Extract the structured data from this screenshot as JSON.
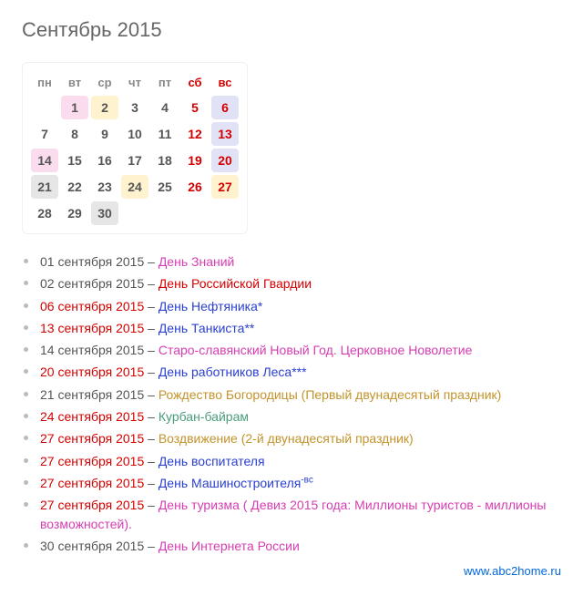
{
  "title": "Сентябрь 2015",
  "weekdays": [
    "пн",
    "вт",
    "ср",
    "чт",
    "пт",
    "сб",
    "вс"
  ],
  "calendar": [
    [
      null,
      {
        "d": 1,
        "hl": "pink"
      },
      {
        "d": 2,
        "hl": "yellow"
      },
      {
        "d": 3
      },
      {
        "d": 4
      },
      {
        "d": 5,
        "w": true
      },
      {
        "d": 6,
        "w": true,
        "hl": "violet"
      }
    ],
    [
      {
        "d": 7
      },
      {
        "d": 8
      },
      {
        "d": 9
      },
      {
        "d": 10
      },
      {
        "d": 11
      },
      {
        "d": 12,
        "w": true
      },
      {
        "d": 13,
        "w": true,
        "hl": "violet"
      }
    ],
    [
      {
        "d": 14,
        "hl": "pink"
      },
      {
        "d": 15
      },
      {
        "d": 16
      },
      {
        "d": 17
      },
      {
        "d": 18
      },
      {
        "d": 19,
        "w": true
      },
      {
        "d": 20,
        "w": true,
        "hl": "violet"
      }
    ],
    [
      {
        "d": 21,
        "hl": "grey"
      },
      {
        "d": 22
      },
      {
        "d": 23
      },
      {
        "d": 24,
        "hl": "yellow"
      },
      {
        "d": 25
      },
      {
        "d": 26,
        "w": true
      },
      {
        "d": 27,
        "w": true,
        "hl": "yellow"
      }
    ],
    [
      {
        "d": 28
      },
      {
        "d": 29
      },
      {
        "d": 30,
        "hl": "grey"
      },
      null,
      null,
      null,
      null
    ]
  ],
  "events": [
    {
      "date": "01 сентября 2015",
      "dc": "black",
      "name": "День Знаний",
      "ec": "magenta"
    },
    {
      "date": "02 сентября 2015",
      "dc": "black",
      "name": "День Российской Гвардии",
      "ec": "red"
    },
    {
      "date": "06 сентября 2015",
      "dc": "red",
      "name": "День Нефтяника*",
      "ec": "blue"
    },
    {
      "date": "13 сентября 2015",
      "dc": "red",
      "name": "День Танкиста**",
      "ec": "blue"
    },
    {
      "date": "14 сентября 2015",
      "dc": "black",
      "name": "Старо-славянский Новый Год. Церковное Новолетие",
      "ec": "magenta"
    },
    {
      "date": "20 сентября 2015",
      "dc": "red",
      "name": "День работников Леса***",
      "ec": "blue"
    },
    {
      "date": "21 сентября 2015",
      "dc": "black",
      "name": "Рождество Богородицы (Первый двунадесятый праздник)",
      "ec": "olive"
    },
    {
      "date": "24 сентября 2015",
      "dc": "red",
      "name": "Курбан-байрам",
      "ec": "teal"
    },
    {
      "date": "27 сентября 2015",
      "dc": "red",
      "name": "Воздвижение (2-й двунадесятый праздник)",
      "ec": "olive"
    },
    {
      "date": "27 сентября 2015",
      "dc": "red",
      "name": "День воспитателя",
      "ec": "blue"
    },
    {
      "date": "27 сентября 2015",
      "dc": "red",
      "name": "День Машиностроителя",
      "sup": "-вс",
      "ec": "blue"
    },
    {
      "date": "27 сентября 2015",
      "dc": "red",
      "name": "День туризма ( Девиз 2015 года: Миллионы туристов - миллионы возможностей).",
      "ec": "magenta"
    },
    {
      "date": "30 сентября 2015",
      "dc": "black",
      "name": "День Интернета России",
      "ec": "magenta"
    }
  ],
  "footer": {
    "label": "www.abc2home.ru"
  }
}
